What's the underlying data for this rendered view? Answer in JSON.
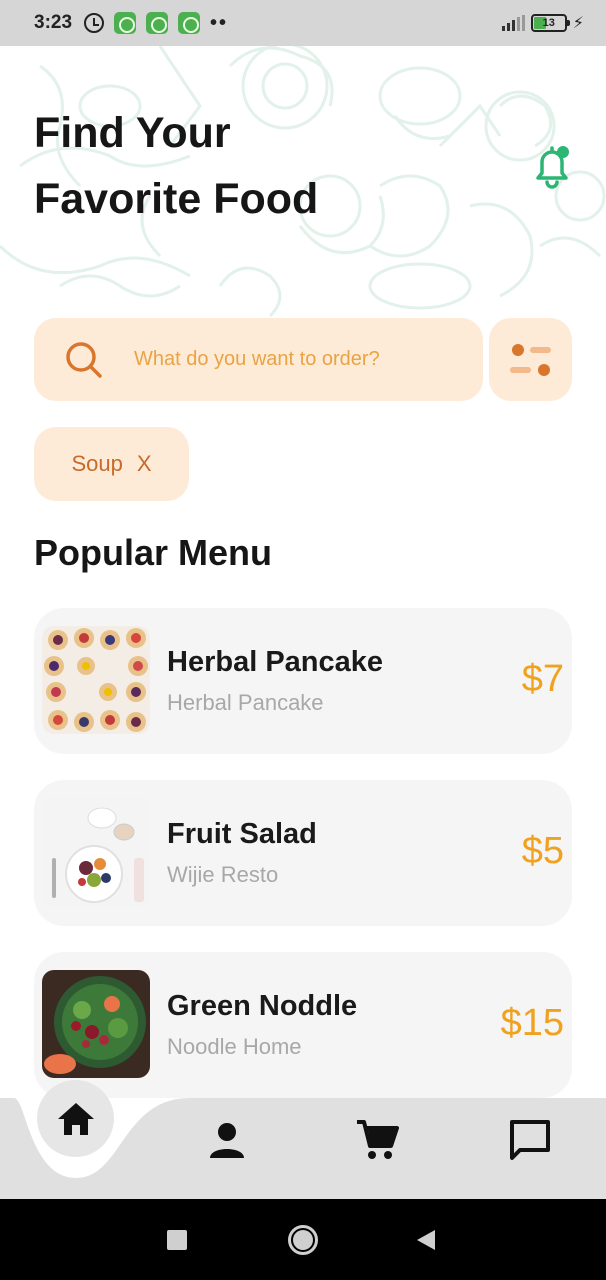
{
  "status_bar": {
    "time": "3:23",
    "battery": "13",
    "dots": "••"
  },
  "header": {
    "title_line1": "Find Your",
    "title_line2": "Favorite Food"
  },
  "search": {
    "placeholder": "What do you want to order?"
  },
  "filter_chip": {
    "label": "Soup",
    "remove": "X"
  },
  "section": {
    "title": "Popular Menu"
  },
  "menu_items": [
    {
      "name": "Herbal Pancake",
      "subtitle": "Herbal Pancake",
      "price": "$7"
    },
    {
      "name": "Fruit Salad",
      "subtitle": "Wijie Resto",
      "price": "$5"
    },
    {
      "name": "Green Noddle",
      "subtitle": "Noodle Home",
      "price": "$15"
    }
  ],
  "colors": {
    "accent_orange": "#f0a21f",
    "search_bg": "#fdebd8",
    "bell_green": "#2bb673",
    "icon_orange": "#d9762c"
  },
  "icons": {
    "bell": "notification-bell-icon",
    "search": "search-icon",
    "filter": "filter-icon",
    "home": "home-icon",
    "profile": "profile-icon",
    "cart": "cart-icon",
    "chat": "chat-icon"
  }
}
